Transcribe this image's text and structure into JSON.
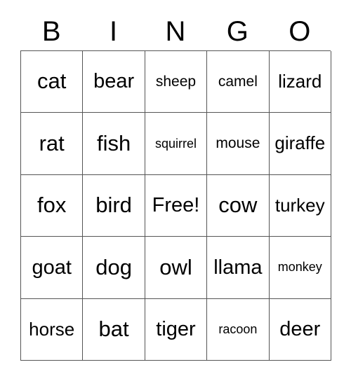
{
  "card": {
    "title_letters": [
      "B",
      "I",
      "N",
      "G",
      "O"
    ],
    "free_space_label": "Free!",
    "grid": {
      "columns": 5,
      "rows": 5,
      "cells": [
        [
          "cat",
          "bear",
          "sheep",
          "camel",
          "lizard"
        ],
        [
          "rat",
          "fish",
          "squirrel",
          "mouse",
          "giraffe"
        ],
        [
          "fox",
          "bird",
          "Free!",
          "cow",
          "turkey"
        ],
        [
          "goat",
          "dog",
          "owl",
          "llama",
          "monkey"
        ],
        [
          "horse",
          "bat",
          "tiger",
          "racoon",
          "deer"
        ]
      ]
    },
    "colors": {
      "background": "#ffffff",
      "text": "#000000",
      "grid_line": "#555555"
    }
  }
}
